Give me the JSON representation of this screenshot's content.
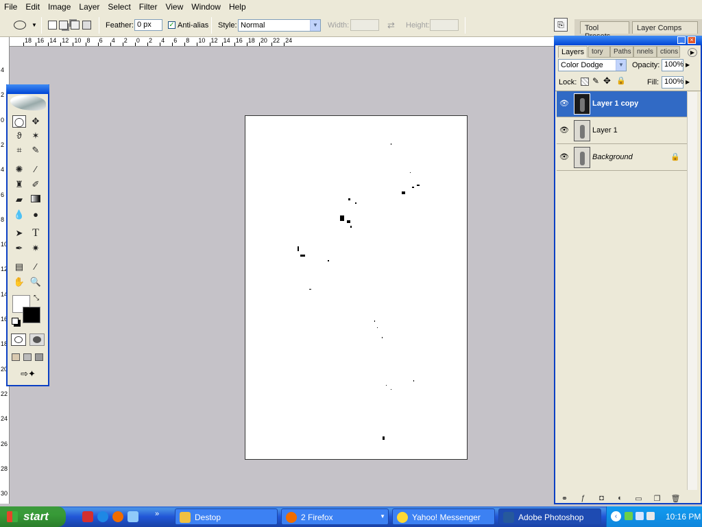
{
  "menu": [
    "File",
    "Edit",
    "Image",
    "Layer",
    "Select",
    "Filter",
    "View",
    "Window",
    "Help"
  ],
  "options": {
    "feather_label": "Feather:",
    "feather_value": "0 px",
    "antialias_label": "Anti-alias",
    "style_label": "Style:",
    "style_value": "Normal",
    "width_label": "Width:",
    "height_label": "Height:"
  },
  "panel_tabs": [
    "Tool Presets",
    "Layer Comps"
  ],
  "hruler": [
    {
      "label": "18"
    },
    {
      "label": "16"
    },
    {
      "label": "14"
    },
    {
      "label": "12"
    },
    {
      "label": "10"
    },
    {
      "label": "8"
    },
    {
      "label": "6"
    },
    {
      "label": "4"
    },
    {
      "label": "2"
    },
    {
      "label": "0"
    },
    {
      "label": "2"
    },
    {
      "label": "4"
    },
    {
      "label": "6"
    },
    {
      "label": "8"
    },
    {
      "label": "10"
    },
    {
      "label": "12"
    },
    {
      "label": "14"
    },
    {
      "label": "16"
    },
    {
      "label": "18"
    },
    {
      "label": "20"
    },
    {
      "label": "22"
    },
    {
      "label": "24"
    }
  ],
  "vruler": [
    "4",
    "2",
    "0",
    "2",
    "4",
    "6",
    "8",
    "10",
    "12",
    "14",
    "16",
    "18",
    "20",
    "22",
    "24",
    "26",
    "28",
    "30"
  ],
  "layers_panel": {
    "tabs": [
      "Layers",
      "tory",
      "Paths",
      "nnels",
      "ctions"
    ],
    "blend_mode": "Color Dodge",
    "opacity_label": "Opacity:",
    "opacity_value": "100%",
    "lock_label": "Lock:",
    "fill_label": "Fill:",
    "fill_value": "100%",
    "layers": [
      {
        "name": "Layer 1 copy",
        "selected": true
      },
      {
        "name": "Layer 1",
        "selected": false
      },
      {
        "name": "Background",
        "selected": false,
        "locked": true
      }
    ]
  },
  "taskbar": {
    "start_label": "start",
    "buttons": [
      "Destop",
      "2 Firefox",
      "Yahoo! Messenger",
      "Adobe Photoshop"
    ],
    "clock": "10:16 PM"
  },
  "colors": {
    "accent": "#0a3fc4",
    "selection": "#316ac5",
    "taskbar": "#2157d7",
    "start": "#379a37"
  }
}
